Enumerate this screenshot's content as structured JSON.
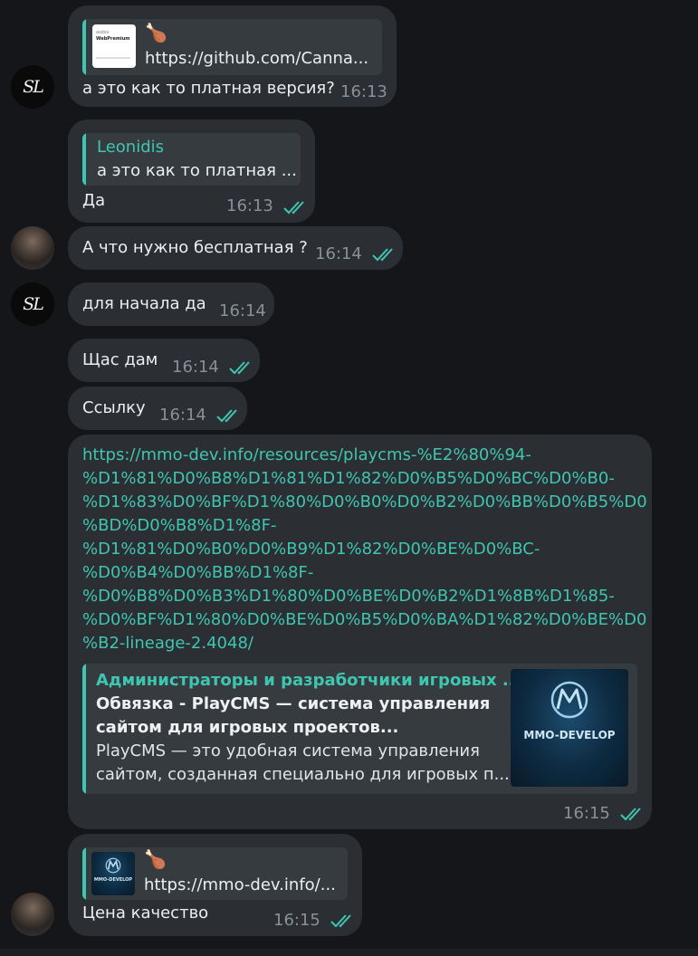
{
  "messages": {
    "m1": {
      "reply_emoji": "🍗",
      "reply_link": "https://github.com/Canna...",
      "thumb_line1": "asdsv",
      "thumb_line2": "WebPremium",
      "text": "а это как то платная версия?",
      "time": "16:13"
    },
    "m2": {
      "reply_author": "Leonidis",
      "reply_text": "а это как то платная ...",
      "text": "Да",
      "time": "16:13"
    },
    "m3": {
      "text": "А что нужно бесплатная ?",
      "time": "16:14"
    },
    "m4": {
      "text": "для начала да",
      "time": "16:14"
    },
    "m5": {
      "text": "Щас дам",
      "time": "16:14"
    },
    "m6": {
      "text": "Ссылку",
      "time": "16:14"
    },
    "m7": {
      "link_lines": [
        "https://mmo-dev.info/resources/playcms-%E2%80%94-",
        "%D1%81%D0%B8%D1%81%D1%82%D0%B5%D0%BC%D0%B0-",
        "%D1%83%D0%BF%D1%80%D0%B0%D0%B2%D0%BB%D0%B5%D0",
        "%BD%D0%B8%D1%8F-",
        "%D1%81%D0%B0%D0%B9%D1%82%D0%BE%D0%BC-",
        "%D0%B4%D0%BB%D1%8F-",
        "%D0%B8%D0%B3%D1%80%D0%BE%D0%B2%D1%8B%D1%85-",
        "%D0%BF%D1%80%D0%BE%D0%B5%D0%BA%D1%82%D0%BE%D0",
        "%B2-lineage-2.4048/"
      ],
      "preview": {
        "site": "Администраторы и разработчики игровых ...",
        "title_lines": [
          "Обвязка - PlayCMS — система управления",
          "сайтом для игровых проектов..."
        ],
        "desc_lines": [
          "PlayCMS — это удобная система управления",
          "сайтом, созданная специально для игровых п..."
        ],
        "logo_text": "MMO-DEVELOP"
      },
      "time": "16:15"
    },
    "m8": {
      "reply_emoji": "🍗",
      "reply_link": "https://mmo-dev.info/...",
      "thumb_text": "MMO-DEVELOP",
      "text": "Цена качество",
      "time": "16:15"
    }
  },
  "avatars": {
    "sl_initials": "SL"
  },
  "colors": {
    "accent": "#3fc6b0",
    "bubble": "#2b2e33",
    "background": "#151619"
  }
}
